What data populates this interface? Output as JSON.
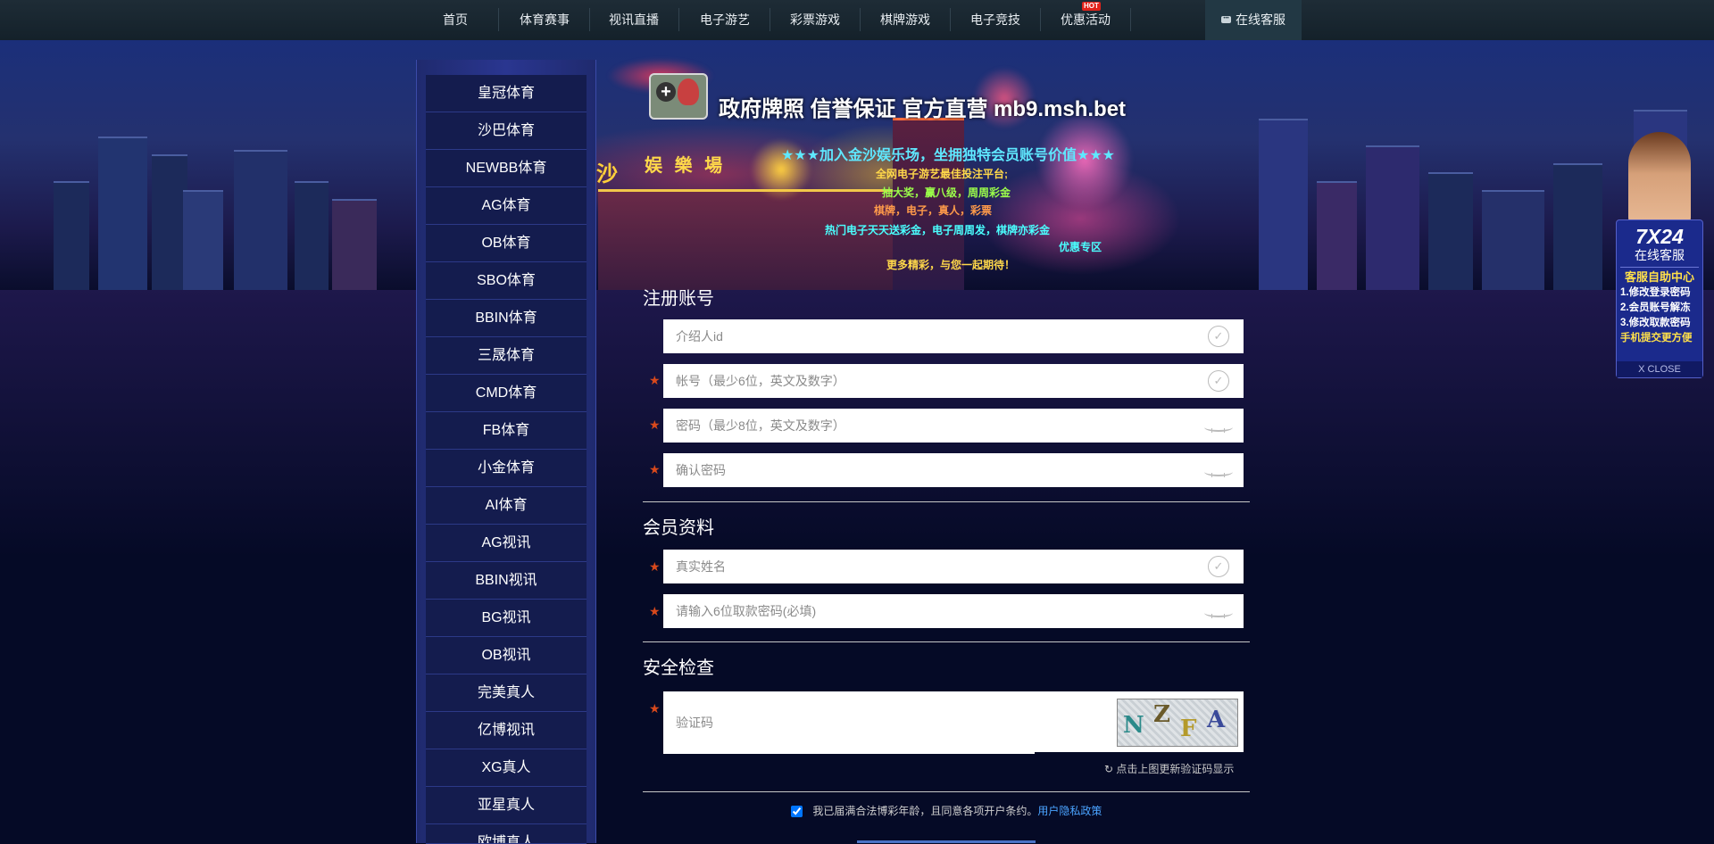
{
  "topnav": {
    "items": [
      {
        "label": "首页"
      },
      {
        "label": "体育赛事"
      },
      {
        "label": "视讯直播"
      },
      {
        "label": "电子游艺"
      },
      {
        "label": "彩票游戏"
      },
      {
        "label": "棋牌游戏"
      },
      {
        "label": "电子竞技"
      },
      {
        "label": "优惠活动"
      }
    ],
    "hot_badge": "HOT",
    "service_label": "在线客服"
  },
  "banner": {
    "title": "政府牌照 信誉保证 官方直营 mb9.msh.bet",
    "sign_text": "娱 樂 場",
    "sign_char": "沙",
    "lines": [
      "★★★加入金沙娱乐场，坐拥独特会员账号价值★★★",
      "全网电子游艺最佳投注平台;",
      "抽大奖，赢八级，周周彩金",
      "棋牌，电子，真人，彩票",
      "热门电子天天送彩金，电子周周发，棋牌亦彩金",
      "优惠专区",
      "更多精彩，与您一起期待！"
    ]
  },
  "sidebar": {
    "items": [
      {
        "label": "皇冠体育"
      },
      {
        "label": "沙巴体育"
      },
      {
        "label": "NEWBB体育"
      },
      {
        "label": "AG体育"
      },
      {
        "label": "OB体育"
      },
      {
        "label": "SBO体育"
      },
      {
        "label": "BBIN体育"
      },
      {
        "label": "三晟体育"
      },
      {
        "label": "CMD体育"
      },
      {
        "label": "FB体育"
      },
      {
        "label": "小金体育"
      },
      {
        "label": "AI体育"
      },
      {
        "label": "AG视讯"
      },
      {
        "label": "BBIN视讯"
      },
      {
        "label": "BG视讯"
      },
      {
        "label": "OB视讯"
      },
      {
        "label": "完美真人"
      },
      {
        "label": "亿博视讯"
      },
      {
        "label": "XG真人"
      },
      {
        "label": "亚星真人"
      },
      {
        "label": "欧博真人"
      }
    ]
  },
  "form": {
    "register_title": "注册账号",
    "referrer_placeholder": "介绍人id",
    "account_placeholder": "帐号（最少6位，英文及数字）",
    "password_placeholder": "密码（最少8位，英文及数字）",
    "confirm_placeholder": "确认密码",
    "member_title": "会员资料",
    "realname_placeholder": "真实姓名",
    "withdraw_pwd_placeholder": "请输入6位取款密码(必填)",
    "security_title": "安全检查",
    "captcha_placeholder": "验证码",
    "captcha_chars": [
      "N",
      "Z",
      "F",
      "A"
    ],
    "refresh_text": "点击上图更新验证码显示",
    "agree_text": "我已届满合法博彩年龄，且同意各项开户条约。",
    "privacy_link": "用户隐私政策",
    "required_mark": "★"
  },
  "float_cs": {
    "big": "7X24",
    "sub": "在线客服",
    "head": "客服自助中心",
    "items": [
      "1.修改登录密码",
      "2.会员账号解冻",
      "3.修改取款密码",
      "手机提交更方便"
    ],
    "close": "X CLOSE"
  },
  "colors": {
    "nav_bg": "#1a2832",
    "sidebar_bg": "#141c4e",
    "required": "#d8491c",
    "link": "#4aa3ff"
  }
}
